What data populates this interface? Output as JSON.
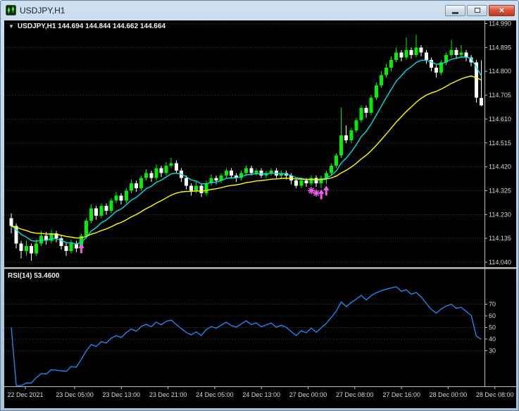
{
  "window": {
    "title": "USDJPY,H1",
    "close_glyph": "×"
  },
  "header": {
    "toggle_icon": "▼",
    "ohlc_line": "USDJPY,H1 144.694 144.844 144.662 144.664"
  },
  "rsi": {
    "label": "RSI(14) 53.4600"
  },
  "colors": {
    "bg": "#000000",
    "grid": "#3c3c3c",
    "separator": "#b9bec3",
    "axis_text": "#d9d9d9",
    "bull": "#00f000",
    "bear": "#ffffff",
    "ma_fast": "#00e0e0",
    "ma_slow": "#ffff00",
    "rsi": "#1e90ff",
    "marker": "#f25af2"
  },
  "chart_data": [
    {
      "type": "candlestick",
      "symbol": "USDJPY",
      "timeframe": "H1",
      "title": "USDJPY,H1 144.694 144.844 144.662 144.664",
      "ylim": [
        114.04,
        114.99
      ],
      "y_ticks": [
        114.99,
        114.895,
        114.8,
        114.705,
        114.61,
        114.515,
        114.42,
        114.325,
        114.23,
        114.135,
        114.04
      ],
      "x_tick_labels": [
        "22 Dec 2021",
        "23 Dec 05:00",
        "23 Dec 13:00",
        "23 Dec 21:00",
        "24 Dec 05:00",
        "24 Dec 13:00",
        "27 Dec 00:00",
        "27 Dec 08:00",
        "27 Dec 16:00",
        "28 Dec 00:00",
        "28 Dec 08:00"
      ],
      "candles": [
        [
          114.215,
          114.235,
          114.155,
          114.185
        ],
        [
          114.185,
          114.195,
          114.095,
          114.115
        ],
        [
          114.115,
          114.125,
          114.055,
          114.085
        ],
        [
          114.085,
          114.125,
          114.065,
          114.105
        ],
        [
          114.105,
          114.115,
          114.045,
          114.075
        ],
        [
          114.075,
          114.13,
          114.065,
          114.115
        ],
        [
          114.115,
          114.165,
          114.105,
          114.145
        ],
        [
          114.145,
          114.16,
          114.11,
          114.125
        ],
        [
          114.125,
          114.17,
          114.115,
          114.155
        ],
        [
          114.155,
          114.165,
          114.12,
          114.135
        ],
        [
          114.135,
          114.145,
          114.09,
          114.105
        ],
        [
          114.105,
          114.12,
          114.065,
          114.085
        ],
        [
          114.085,
          114.13,
          114.075,
          114.115
        ],
        [
          114.115,
          114.125,
          114.08,
          114.095
        ],
        [
          114.095,
          114.155,
          114.085,
          114.145
        ],
        [
          114.145,
          114.215,
          114.135,
          114.205
        ],
        [
          114.205,
          114.27,
          114.195,
          114.255
        ],
        [
          114.255,
          114.265,
          114.21,
          114.225
        ],
        [
          114.225,
          114.275,
          114.215,
          114.265
        ],
        [
          114.265,
          114.275,
          114.23,
          114.245
        ],
        [
          114.245,
          114.295,
          114.235,
          114.285
        ],
        [
          114.285,
          114.32,
          114.275,
          114.305
        ],
        [
          114.305,
          114.315,
          114.27,
          114.285
        ],
        [
          114.285,
          114.335,
          114.275,
          114.325
        ],
        [
          114.325,
          114.37,
          114.315,
          114.355
        ],
        [
          114.355,
          114.365,
          114.32,
          114.335
        ],
        [
          114.335,
          114.385,
          114.325,
          114.375
        ],
        [
          114.375,
          114.41,
          114.365,
          114.395
        ],
        [
          114.395,
          114.405,
          114.36,
          114.375
        ],
        [
          114.375,
          114.43,
          114.365,
          114.415
        ],
        [
          114.415,
          114.425,
          114.38,
          114.395
        ],
        [
          114.395,
          114.44,
          114.385,
          114.425
        ],
        [
          114.425,
          114.455,
          114.415,
          114.435
        ],
        [
          114.435,
          114.445,
          114.395,
          114.405
        ],
        [
          114.405,
          114.415,
          114.36,
          114.375
        ],
        [
          114.375,
          114.385,
          114.33,
          114.345
        ],
        [
          114.345,
          114.355,
          114.305,
          114.325
        ],
        [
          114.325,
          114.36,
          114.315,
          114.345
        ],
        [
          114.345,
          114.355,
          114.3,
          114.315
        ],
        [
          114.315,
          114.365,
          114.305,
          114.355
        ],
        [
          114.355,
          114.39,
          114.345,
          114.375
        ],
        [
          114.375,
          114.385,
          114.35,
          114.365
        ],
        [
          114.365,
          114.395,
          114.355,
          114.385
        ],
        [
          114.385,
          114.415,
          114.375,
          114.405
        ],
        [
          114.405,
          114.415,
          114.375,
          114.385
        ],
        [
          114.385,
          114.395,
          114.36,
          114.375
        ],
        [
          114.375,
          114.405,
          114.365,
          114.395
        ],
        [
          114.395,
          114.425,
          114.385,
          114.415
        ],
        [
          114.415,
          114.425,
          114.385,
          114.395
        ],
        [
          114.395,
          114.415,
          114.385,
          114.405
        ],
        [
          114.405,
          114.415,
          114.375,
          114.385
        ],
        [
          114.385,
          114.405,
          114.375,
          114.395
        ],
        [
          114.395,
          114.415,
          114.385,
          114.405
        ],
        [
          114.405,
          114.415,
          114.375,
          114.385
        ],
        [
          114.385,
          114.405,
          114.375,
          114.395
        ],
        [
          114.395,
          114.405,
          114.37,
          114.385
        ],
        [
          114.385,
          114.395,
          114.35,
          114.365
        ],
        [
          114.365,
          114.375,
          114.335,
          114.345
        ],
        [
          114.345,
          114.375,
          114.335,
          114.365
        ],
        [
          114.365,
          114.375,
          114.34,
          114.355
        ],
        [
          114.355,
          114.385,
          114.345,
          114.375
        ],
        [
          114.375,
          114.385,
          114.34,
          114.355
        ],
        [
          114.355,
          114.385,
          114.335,
          114.375
        ],
        [
          114.375,
          114.405,
          114.35,
          114.395
        ],
        [
          114.395,
          114.435,
          114.385,
          114.425
        ],
        [
          114.425,
          114.475,
          114.415,
          114.465
        ],
        [
          114.465,
          114.655,
          114.455,
          114.545
        ],
        [
          114.545,
          114.585,
          114.515,
          114.525
        ],
        [
          114.525,
          114.575,
          114.515,
          114.565
        ],
        [
          114.565,
          114.615,
          114.555,
          114.605
        ],
        [
          114.605,
          114.665,
          114.595,
          114.655
        ],
        [
          114.655,
          114.665,
          114.615,
          114.635
        ],
        [
          114.635,
          114.705,
          114.625,
          114.695
        ],
        [
          114.695,
          114.755,
          114.685,
          114.745
        ],
        [
          114.745,
          114.8,
          114.735,
          114.785
        ],
        [
          114.785,
          114.83,
          114.775,
          114.815
        ],
        [
          114.815,
          114.86,
          114.8,
          114.845
        ],
        [
          114.845,
          114.895,
          114.835,
          114.875
        ],
        [
          114.875,
          114.885,
          114.84,
          114.855
        ],
        [
          114.855,
          114.935,
          114.845,
          114.885
        ],
        [
          114.885,
          114.895,
          114.85,
          114.865
        ],
        [
          114.865,
          114.945,
          114.855,
          114.895
        ],
        [
          114.895,
          114.905,
          114.86,
          114.875
        ],
        [
          114.875,
          114.885,
          114.83,
          114.845
        ],
        [
          114.845,
          114.855,
          114.8,
          114.815
        ],
        [
          114.815,
          114.825,
          114.775,
          114.795
        ],
        [
          114.795,
          114.845,
          114.785,
          114.835
        ],
        [
          114.835,
          114.875,
          114.825,
          114.865
        ],
        [
          114.865,
          114.925,
          114.855,
          114.885
        ],
        [
          114.885,
          114.895,
          114.85,
          114.865
        ],
        [
          114.865,
          114.905,
          114.855,
          114.875
        ],
        [
          114.875,
          114.885,
          114.84,
          114.855
        ],
        [
          114.855,
          114.865,
          114.82,
          114.835
        ],
        [
          114.835,
          114.845,
          114.675,
          114.695
        ],
        [
          114.694,
          114.844,
          114.662,
          114.664
        ]
      ],
      "overlays": [
        {
          "name": "ma-fast-line",
          "style": "ema",
          "period": 8,
          "color_key": "ma_fast"
        },
        {
          "name": "ma-slow-line",
          "style": "ema",
          "period": 24,
          "color_key": "ma_slow"
        }
      ],
      "markers": [
        {
          "index": 14,
          "price": 114.115,
          "glyph": "arrow-up"
        },
        {
          "index": 60,
          "price": 114.345,
          "glyph": "star"
        },
        {
          "index": 61,
          "price": 114.335,
          "glyph": "star"
        },
        {
          "index": 62,
          "price": 114.33,
          "glyph": "arrow-up"
        },
        {
          "index": 63,
          "price": 114.345,
          "glyph": "arrow-up"
        }
      ]
    },
    {
      "type": "line",
      "name": "RSI",
      "label": "RSI(14) 53.4600",
      "period": 14,
      "current_value": "53.4600",
      "ylim": [
        0,
        100
      ],
      "y_ticks": [
        70,
        60,
        50,
        40,
        30
      ],
      "source": "derived from candle closes"
    }
  ]
}
